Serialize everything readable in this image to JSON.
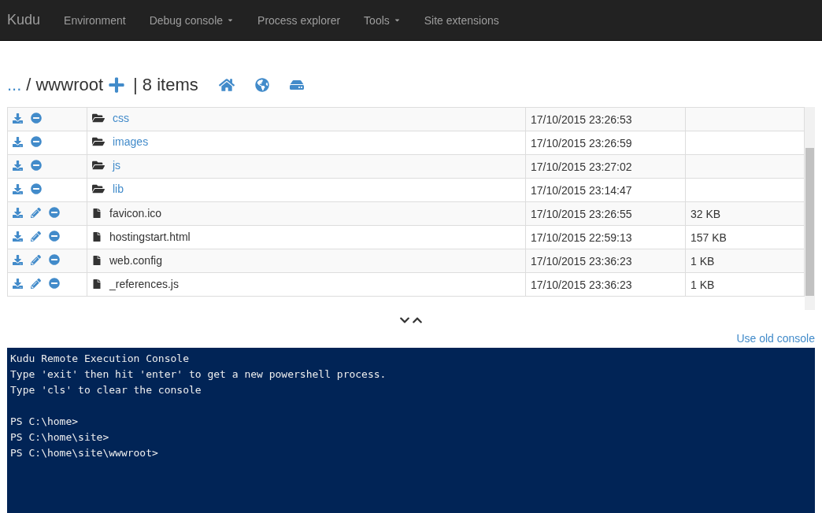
{
  "navbar": {
    "brand": "Kudu",
    "items": [
      {
        "label": "Environment",
        "dropdown": false
      },
      {
        "label": "Debug console",
        "dropdown": true
      },
      {
        "label": "Process explorer",
        "dropdown": false
      },
      {
        "label": "Tools",
        "dropdown": true
      },
      {
        "label": "Site extensions",
        "dropdown": false
      }
    ]
  },
  "breadcrumb": {
    "parent": "...",
    "separator": "/",
    "current": "wwwroot",
    "count": "| 8 items"
  },
  "files": [
    {
      "kind": "folder",
      "name": "css",
      "modified": "17/10/2015 23:26:53"
    },
    {
      "kind": "folder",
      "name": "images",
      "modified": "17/10/2015 23:26:59"
    },
    {
      "kind": "folder",
      "name": "js",
      "modified": "17/10/2015 23:27:02"
    },
    {
      "kind": "folder",
      "name": "lib",
      "modified": "17/10/2015 23:14:47"
    },
    {
      "kind": "file",
      "name": "favicon.ico",
      "modified": "17/10/2015 23:26:55",
      "size": "32 KB"
    },
    {
      "kind": "file",
      "name": "hostingstart.html",
      "modified": "17/10/2015 22:59:13",
      "size": "157 KB"
    },
    {
      "kind": "file",
      "name": "web.config",
      "modified": "17/10/2015 23:36:23",
      "size": "1 KB"
    },
    {
      "kind": "file",
      "name": "_references.js",
      "modified": "17/10/2015 23:36:23",
      "size": "1 KB"
    }
  ],
  "old_console_link": "Use old console",
  "console": {
    "header_lines": [
      "Kudu Remote Execution Console",
      "Type 'exit' then hit 'enter' to get a new powershell process.",
      "Type 'cls' to clear the console"
    ],
    "prompts": [
      "PS C:\\home>",
      "PS C:\\home\\site>",
      "PS C:\\home\\site\\wwwroot>"
    ]
  }
}
